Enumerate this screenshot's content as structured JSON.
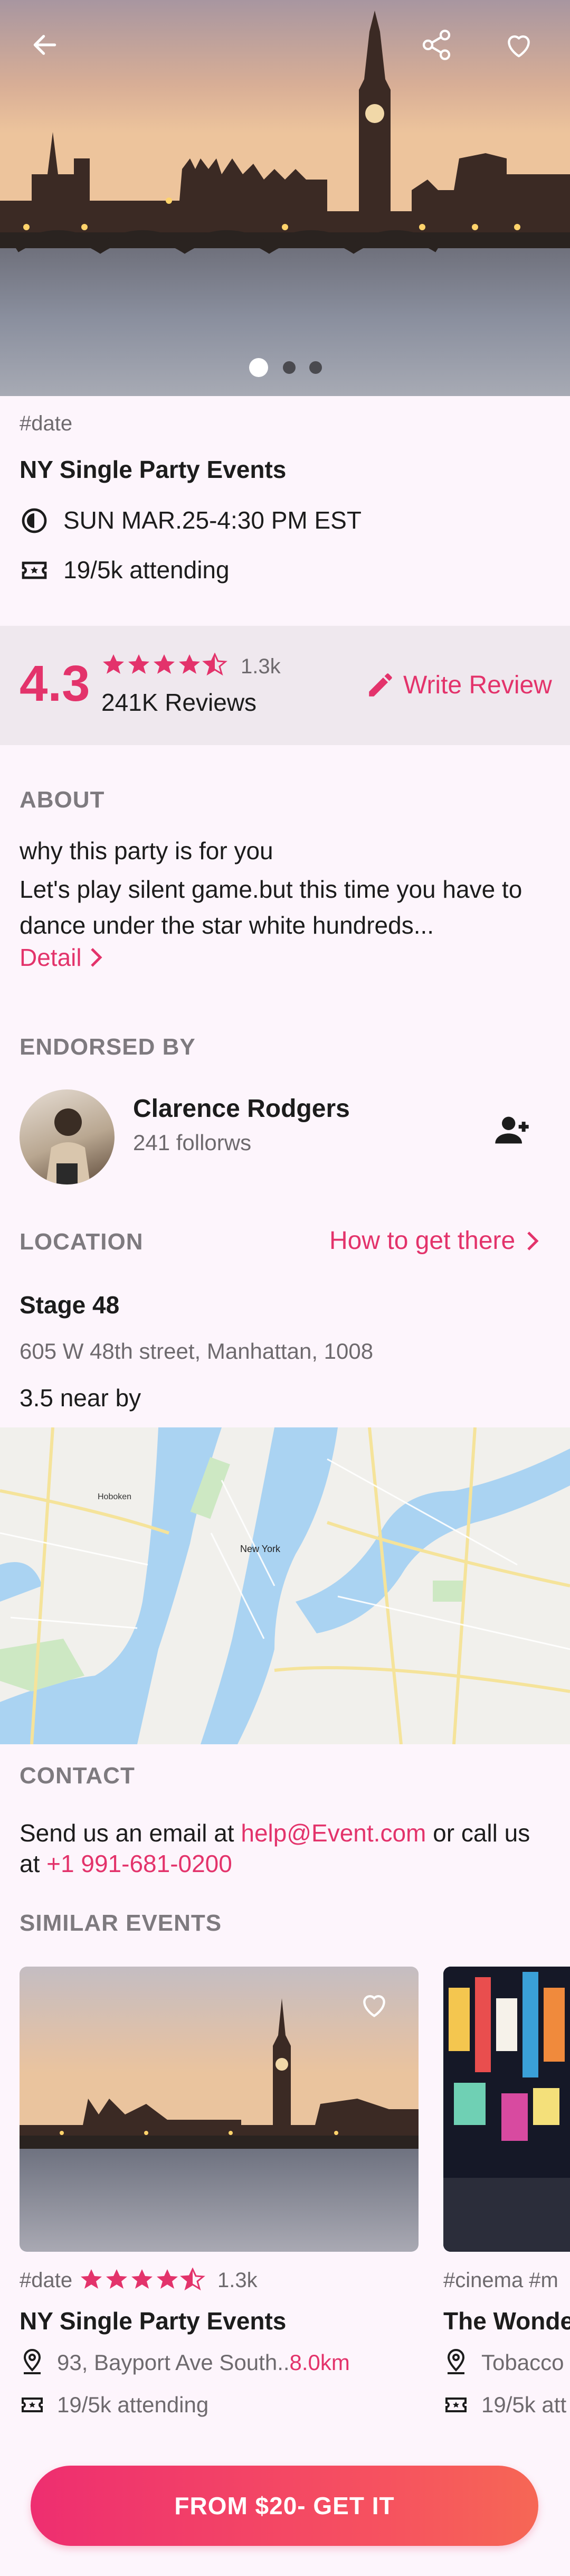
{
  "hero": {
    "back_icon": "arrow-left-icon",
    "share_icon": "share-icon",
    "like_icon": "heart-icon",
    "carousel_pages": 3,
    "carousel_active": 1
  },
  "event": {
    "tag": "#date",
    "title": "NY Single Party Events",
    "datetime": "SUN MAR.25-4:30 PM EST",
    "attending": "19/5k attending"
  },
  "rating": {
    "score": "4.3",
    "stars": 4.5,
    "count_short": "1.3k",
    "reviews": "241K Reviews",
    "write_review": "Write Review"
  },
  "about": {
    "heading": "ABOUT",
    "line1": "why this party is for you",
    "body": "Let's play silent game.but this time you have to dance under the star white hundreds...",
    "detail": "Detail"
  },
  "endorsed": {
    "heading": "ENDORSED BY",
    "name": "Clarence Rodgers",
    "followers": "241 follorws"
  },
  "location": {
    "heading": "LOCATION",
    "directions": "How to get there",
    "venue": "Stage 48",
    "address": "605 W 48th street, Manhattan, 1008",
    "distance": "3.5 near by",
    "map_labels": {
      "hoboken": "Hoboken",
      "newyork": "New York"
    }
  },
  "contact": {
    "heading": "CONTACT",
    "text1": "Send us an email at ",
    "email": "help@Event.com",
    "text2": " or call us",
    "text3": "at ",
    "phone": "+1 991-681-0200"
  },
  "similar": {
    "heading": "SIMILAR EVENTS",
    "cards": [
      {
        "tag": "#date",
        "stars": 4.5,
        "count": "1.3k",
        "title": "NY Single Party Events",
        "address": "93, Bayport Ave South..",
        "distance": "8.0km",
        "attending": "19/5k attending"
      },
      {
        "tag": "#cinema #m",
        "title": "The Wonde",
        "address": "Tobacco",
        "attending": "19/5k att"
      }
    ]
  },
  "cta": {
    "label": "FROM $20- GET IT"
  },
  "colors": {
    "accent": "#e3336b",
    "background": "#fdf5fc",
    "rating_band": "#efe8ee"
  }
}
